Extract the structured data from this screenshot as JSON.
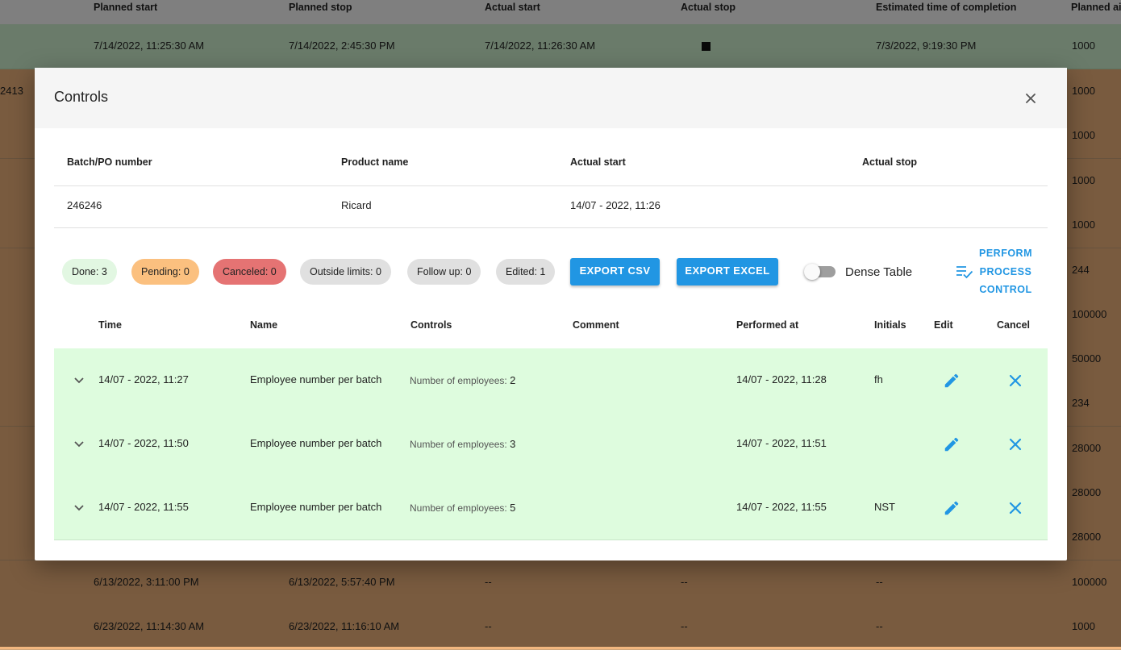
{
  "background": {
    "headers": [
      "Planned start",
      "Planned stop",
      "Actual start",
      "Actual stop",
      "Estimated time of completion",
      "Planned ai"
    ],
    "left_fragment": "2413",
    "rows": [
      {
        "planned_start": "7/14/2022, 11:25:30 AM",
        "planned_stop": "7/14/2022, 2:45:30 PM",
        "actual_start": "7/14/2022, 11:26:30 AM",
        "actual_stop": "■",
        "estimated": "7/3/2022, 9:19:30 PM",
        "planned_amount": "1000"
      },
      {
        "planned_amount": "1000"
      },
      {
        "planned_amount": "1000"
      },
      {
        "planned_amount": "1000"
      },
      {
        "planned_amount": "1000"
      },
      {
        "planned_amount": "244"
      },
      {
        "planned_amount": "100000"
      },
      {
        "planned_amount": "50000"
      },
      {
        "planned_amount": "234"
      },
      {
        "planned_amount": "28000"
      },
      {
        "planned_amount": "28000"
      },
      {
        "planned_amount": "28000"
      },
      {
        "planned_start": "6/13/2022, 3:11:00 PM",
        "planned_stop": "6/13/2022, 5:57:40 PM",
        "actual_start": "--",
        "actual_stop": "--",
        "estimated": "--",
        "planned_amount": "100000"
      },
      {
        "planned_start": "6/23/2022, 11:14:30 AM",
        "planned_stop": "6/23/2022, 11:16:10 AM",
        "actual_start": "--",
        "actual_stop": "--",
        "estimated": "--",
        "planned_amount": "1000"
      }
    ]
  },
  "modal": {
    "title": "Controls",
    "close_icon": "close-icon",
    "info": {
      "headers": [
        "Batch/PO number",
        "Product name",
        "Actual start",
        "Actual stop"
      ],
      "values": [
        "246246",
        "Ricard",
        "14/07 - 2022, 11:26",
        ""
      ]
    },
    "chips": [
      {
        "label": "Done: 3",
        "color": "#e2f7e2"
      },
      {
        "label": "Pending: 0",
        "color": "#fbc07f"
      },
      {
        "label": "Canceled: 0",
        "color": "#e57373"
      },
      {
        "label": "Outside limits: 0",
        "color": "#e0e0e0"
      },
      {
        "label": "Follow up: 0",
        "color": "#e0e0e0"
      },
      {
        "label": "Edited: 1",
        "color": "#e0e0e0"
      }
    ],
    "export_csv": "EXPORT CSV",
    "export_excel": "EXPORT EXCEL",
    "dense_table": "Dense Table",
    "dense_table_on": false,
    "perform": [
      "PERFORM",
      "PROCESS",
      "CONTROL"
    ],
    "perform_icon": "playlist-check-icon",
    "table": {
      "headers": [
        "Time",
        "Name",
        "Controls",
        "Comment",
        "Performed at",
        "Initials",
        "Edit",
        "Cancel"
      ],
      "rows": [
        {
          "time": "14/07 - 2022, 11:27",
          "name": "Employee number per batch",
          "control_label": "Number of employees:",
          "control_value": "2",
          "comment": "",
          "performed_at": "14/07 - 2022, 11:28",
          "initials": "fh"
        },
        {
          "time": "14/07 - 2022, 11:50",
          "name": "Employee number per batch",
          "control_label": "Number of employees:",
          "control_value": "3",
          "comment": "",
          "performed_at": "14/07 - 2022, 11:51",
          "initials": ""
        },
        {
          "time": "14/07 - 2022, 11:55",
          "name": "Employee number per batch",
          "control_label": "Number of employees:",
          "control_value": "5",
          "comment": "",
          "performed_at": "14/07 - 2022, 11:55",
          "initials": "NST"
        }
      ]
    }
  },
  "colors": {
    "accent": "#2196e3",
    "row_done": "#defcde",
    "bg_row_pending": "#f2b77f",
    "bg_row_active": "#d4f6d4"
  }
}
